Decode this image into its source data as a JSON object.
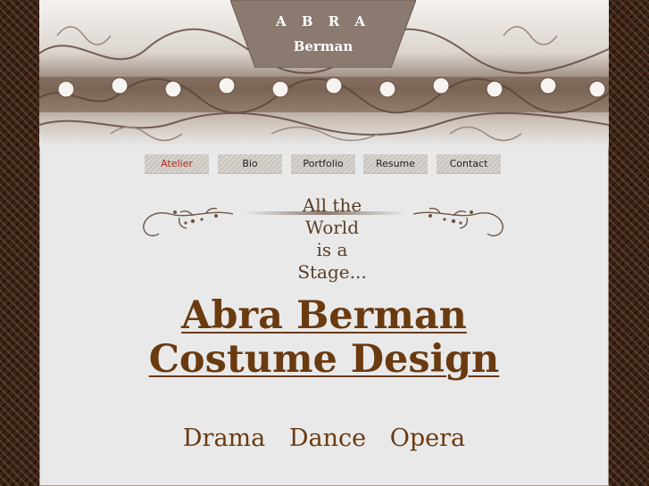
{
  "brand": {
    "line1": "A B R A",
    "line2": "Berman"
  },
  "nav": {
    "items": [
      {
        "label": "Atelier",
        "active": true
      },
      {
        "label": "Bio",
        "active": false
      },
      {
        "label": "Portfolio",
        "active": false
      },
      {
        "label": "Resume",
        "active": false
      },
      {
        "label": "Contact",
        "active": false
      }
    ]
  },
  "tagline": {
    "line1": "All the",
    "line2": "World",
    "line3": "is a",
    "line4": "Stage..."
  },
  "hero": {
    "title_line1": "Abra Berman",
    "title_line2": "Costume Design"
  },
  "disciplines": [
    "Drama",
    "Dance",
    "Opera"
  ],
  "colors": {
    "accent_text": "#6a3a10",
    "active_nav": "#b02a1a",
    "logo_tab": "#8a7a70",
    "frame": "#3a2418"
  }
}
